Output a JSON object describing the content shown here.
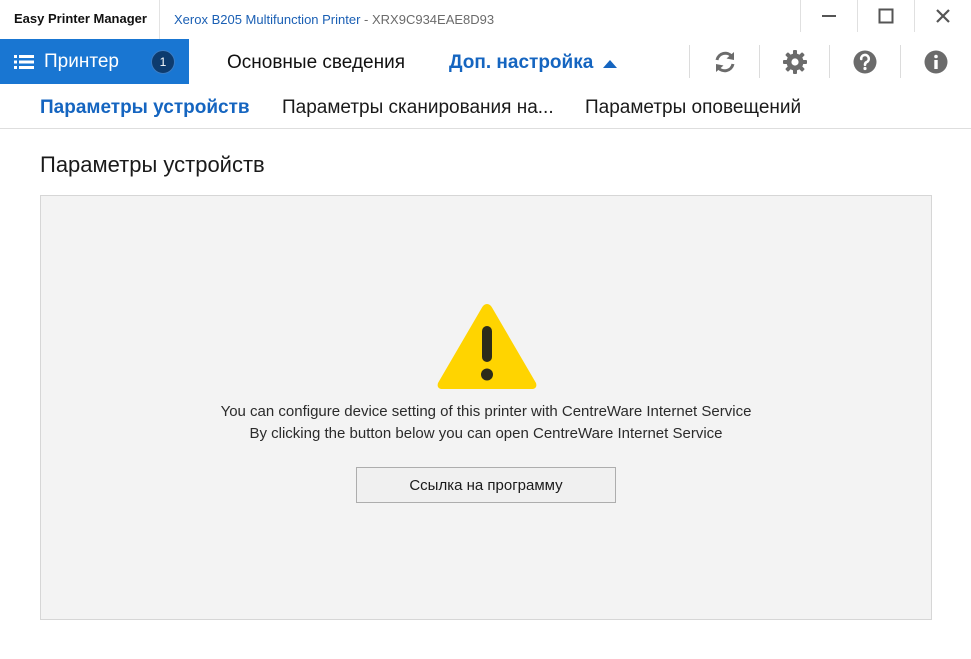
{
  "titlebar": {
    "app_name": "Easy Printer Manager",
    "printer_name": "Xerox B205 Multifunction Printer",
    "printer_separator": " - ",
    "printer_id": "XRX9C934EAE8D93"
  },
  "window_controls": {
    "minimize_icon": "minimize-icon",
    "maximize_icon": "maximize-icon",
    "close_icon": "close-icon"
  },
  "mainnav": {
    "printer_tab_label": "Принтер",
    "printer_count": "1",
    "overview_label": "Основные сведения",
    "advanced_label": "Доп. настройка",
    "tools": [
      "refresh-icon",
      "gear-icon",
      "help-icon",
      "info-icon"
    ]
  },
  "subnav": {
    "items": [
      {
        "label": "Параметры устройств",
        "active": true
      },
      {
        "label": "Параметры сканирования на...",
        "active": false
      },
      {
        "label": "Параметры оповещений",
        "active": false
      }
    ]
  },
  "content": {
    "page_title": "Параметры устройств",
    "message_line1": "You can configure device setting of this printer with CentreWare Internet Service",
    "message_line2": "By clicking the button below you can open CentreWare Internet Service",
    "button_label": "Ссылка на программу"
  },
  "colors": {
    "accent": "#1976d2",
    "accent_text": "#1565c0",
    "badge": "#0d3b6e",
    "warning": "#ffd400",
    "panel_bg": "#f3f3f3"
  }
}
